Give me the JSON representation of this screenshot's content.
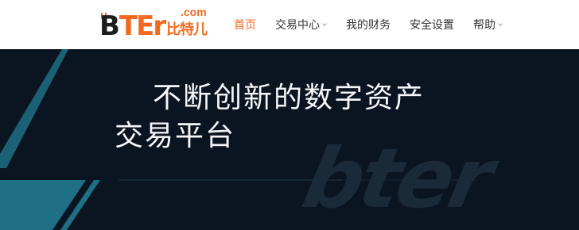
{
  "logo": {
    "b": "B",
    "ter": "TEr",
    "cn": "比特儿",
    "com": ".com"
  },
  "nav": {
    "items": [
      {
        "label": "首页",
        "active": true,
        "has_dropdown": false
      },
      {
        "label": "交易中心",
        "active": false,
        "has_dropdown": true
      },
      {
        "label": "我的财务",
        "active": false,
        "has_dropdown": false
      },
      {
        "label": "安全设置",
        "active": false,
        "has_dropdown": false
      },
      {
        "label": "帮助",
        "active": false,
        "has_dropdown": true
      }
    ]
  },
  "banner": {
    "headline_line1": "不断创新的数字资产",
    "headline_line2": "交易平台",
    "wordmark": "bter"
  },
  "colors": {
    "accent": "#f26a21",
    "banner_bg": "#0b1521",
    "teal": "#1f6f85"
  }
}
